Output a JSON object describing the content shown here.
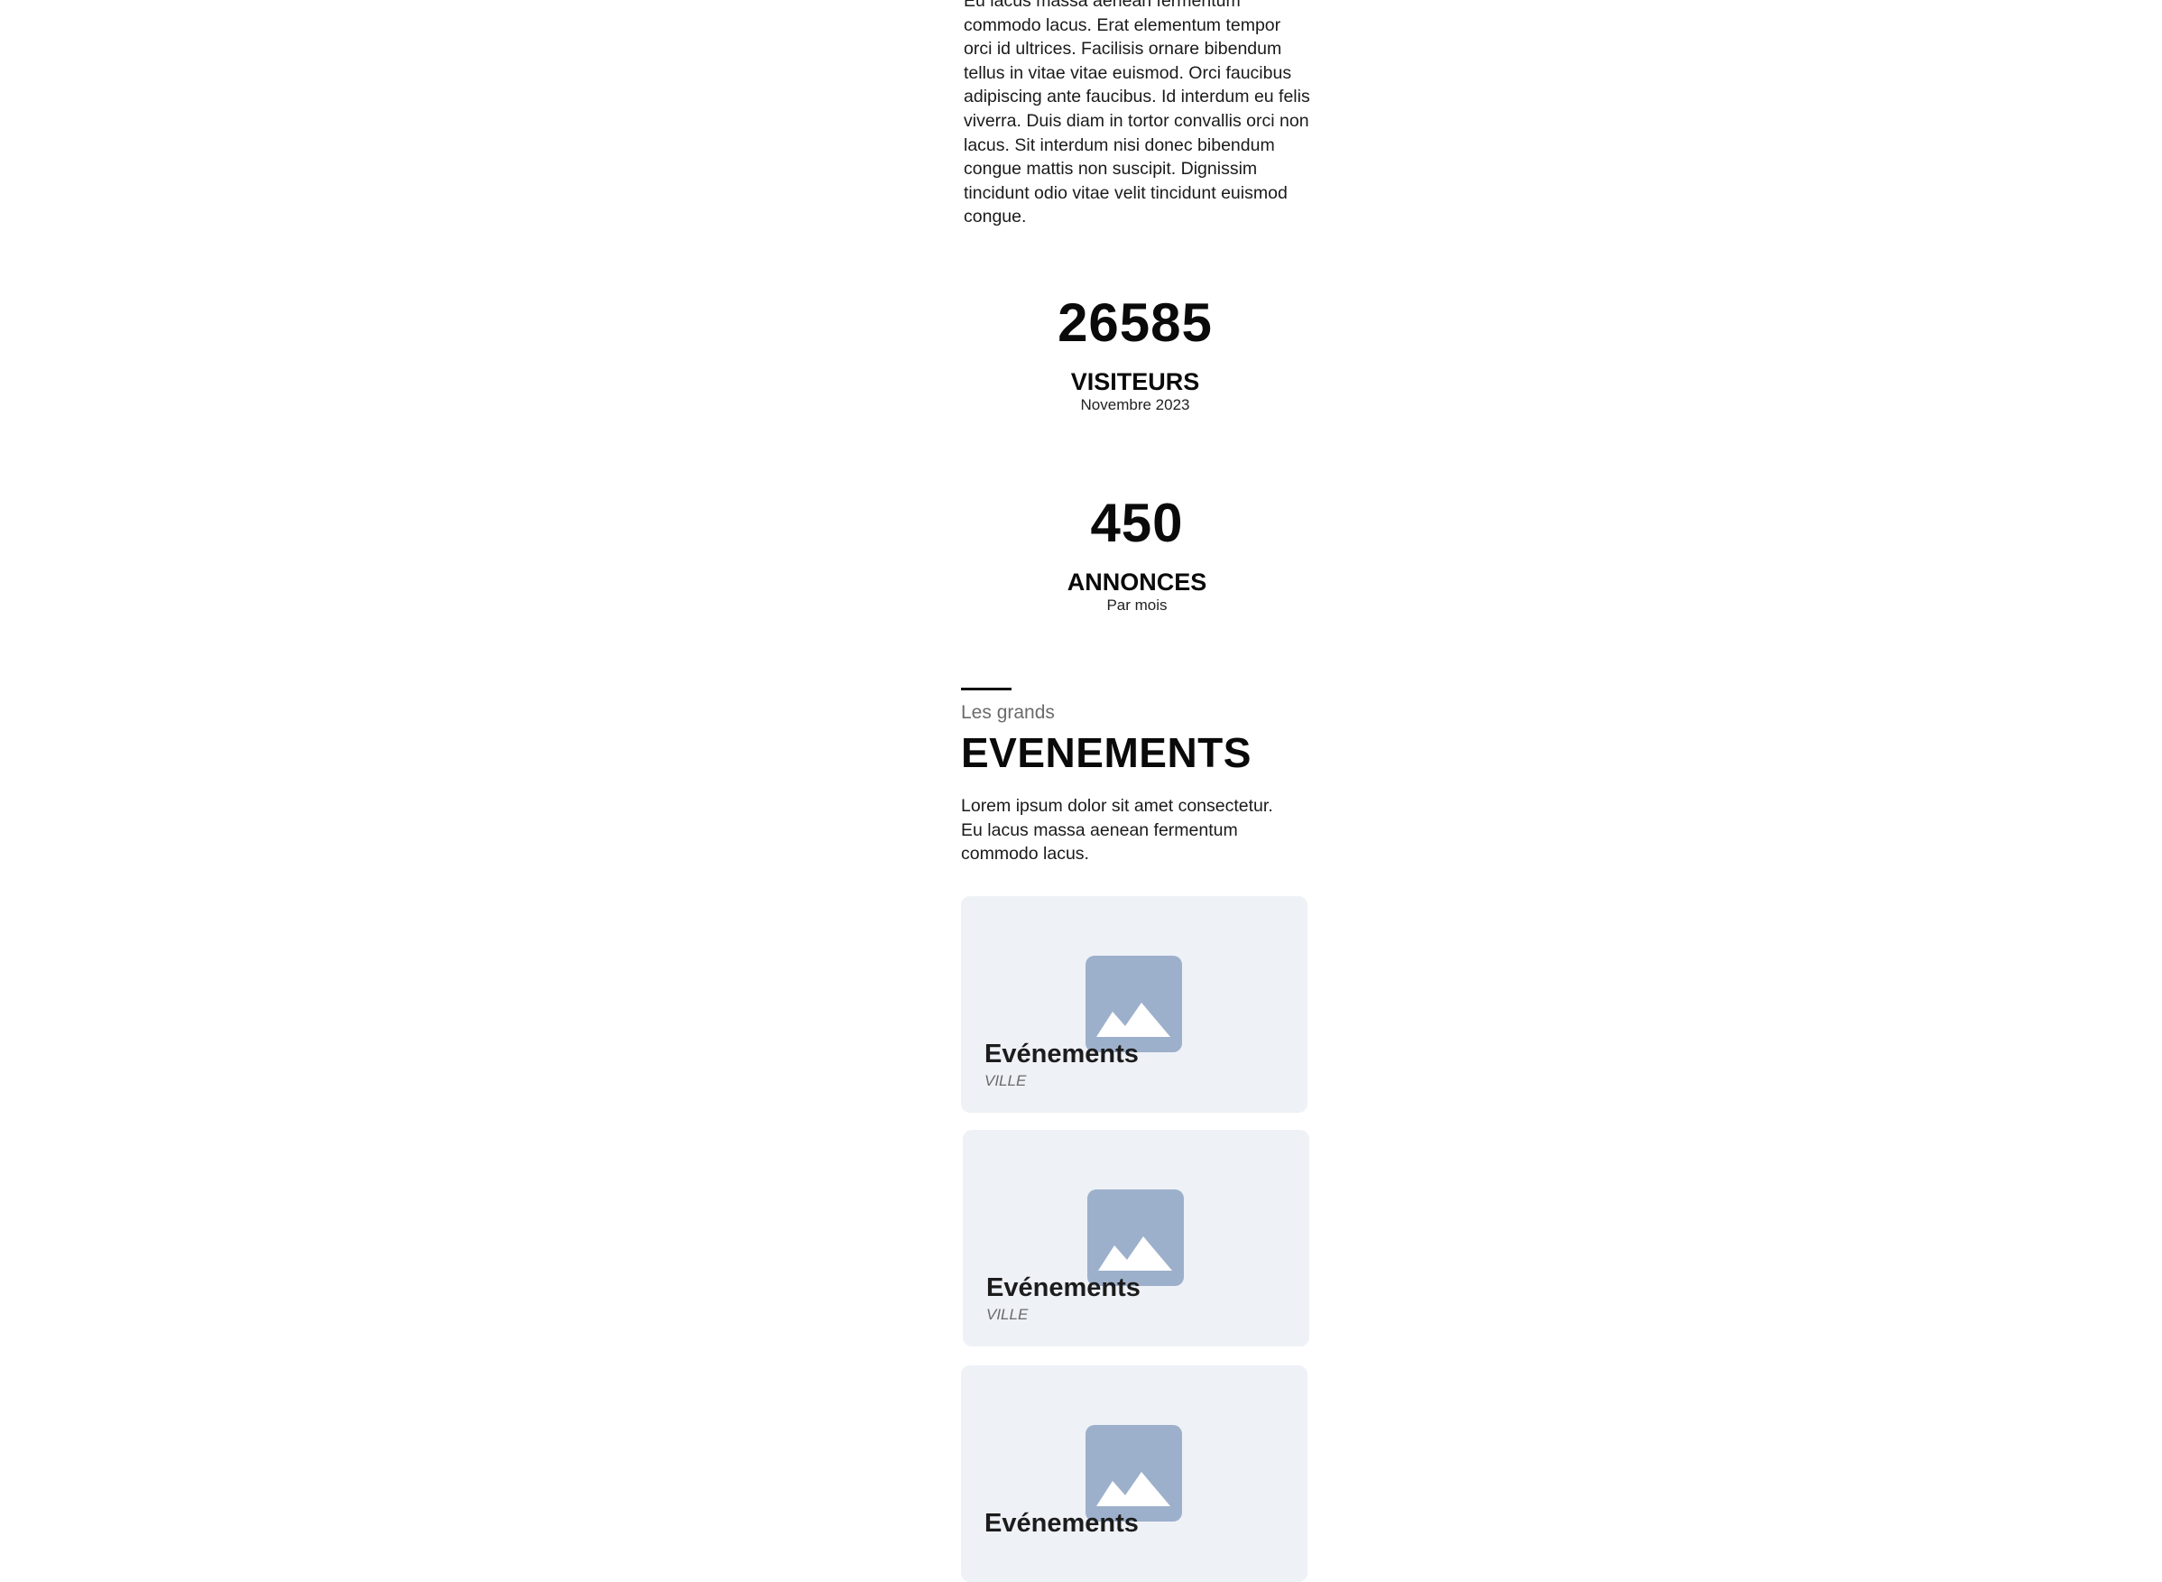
{
  "intro": {
    "text": "Eu lacus massa aenean fermentum commodo lacus. Erat elementum tempor orci id ultrices. Facilisis ornare bibendum tellus in vitae vitae euismod. Orci faucibus adipiscing ante faucibus. Id interdum eu felis viverra. Duis diam in tortor convallis orci non lacus. Sit interdum nisi donec bibendum congue mattis non suscipit. Dignissim tincidunt odio vitae velit tincidunt euismod congue."
  },
  "stats": [
    {
      "number": "26585",
      "label": "VISITEURS",
      "sub": "Novembre 2023"
    },
    {
      "number": "450",
      "label": "ANNONCES",
      "sub": "Par mois"
    }
  ],
  "events_section": {
    "kicker": "Les grands",
    "title": "EVENEMENTS",
    "description": "Lorem ipsum dolor sit amet consectetur. Eu lacus massa aenean fermentum commodo lacus.",
    "cards": [
      {
        "title": "Evénements",
        "city": "VILLE",
        "icon": "image-placeholder-icon"
      },
      {
        "title": "Evénements",
        "city": "VILLE",
        "icon": "image-placeholder-icon"
      },
      {
        "title": "Evénements",
        "city": "",
        "icon": "image-placeholder-icon"
      }
    ]
  },
  "colors": {
    "card_background": "#eef1f6",
    "placeholder_icon": "#9db0cb",
    "text_primary": "#0a0a0a",
    "text_muted": "#6b6b6b"
  }
}
